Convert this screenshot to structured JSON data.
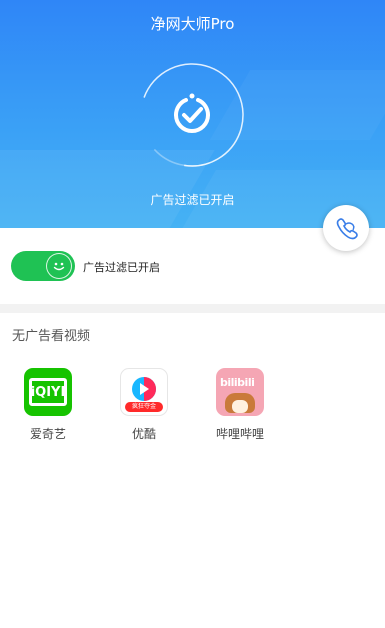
{
  "header": {
    "title": "净网大师Pro",
    "status_text": "广告过滤已开启"
  },
  "colors": {
    "hero_blue": "#2f86f7",
    "switch_green": "#1fc254",
    "iqiyi_green": "#16c300",
    "youku_red": "#ff2a2a",
    "bili_pink": "#f5a6b4"
  },
  "fab": {
    "icon": "phone-mask-icon"
  },
  "toggle": {
    "label": "广告过滤已开启",
    "state": "on"
  },
  "section": {
    "title": "无广告看视频"
  },
  "apps": [
    {
      "name": "爱奇艺",
      "icon_text": "iQIYI",
      "icon": "iqiyi-logo-icon"
    },
    {
      "name": "优酷",
      "icon_text": "疯狂夺金",
      "icon": "youku-logo-icon"
    },
    {
      "name": "哔哩哔哩",
      "icon_text": "bilibili",
      "icon": "bilibili-logo-icon"
    }
  ]
}
